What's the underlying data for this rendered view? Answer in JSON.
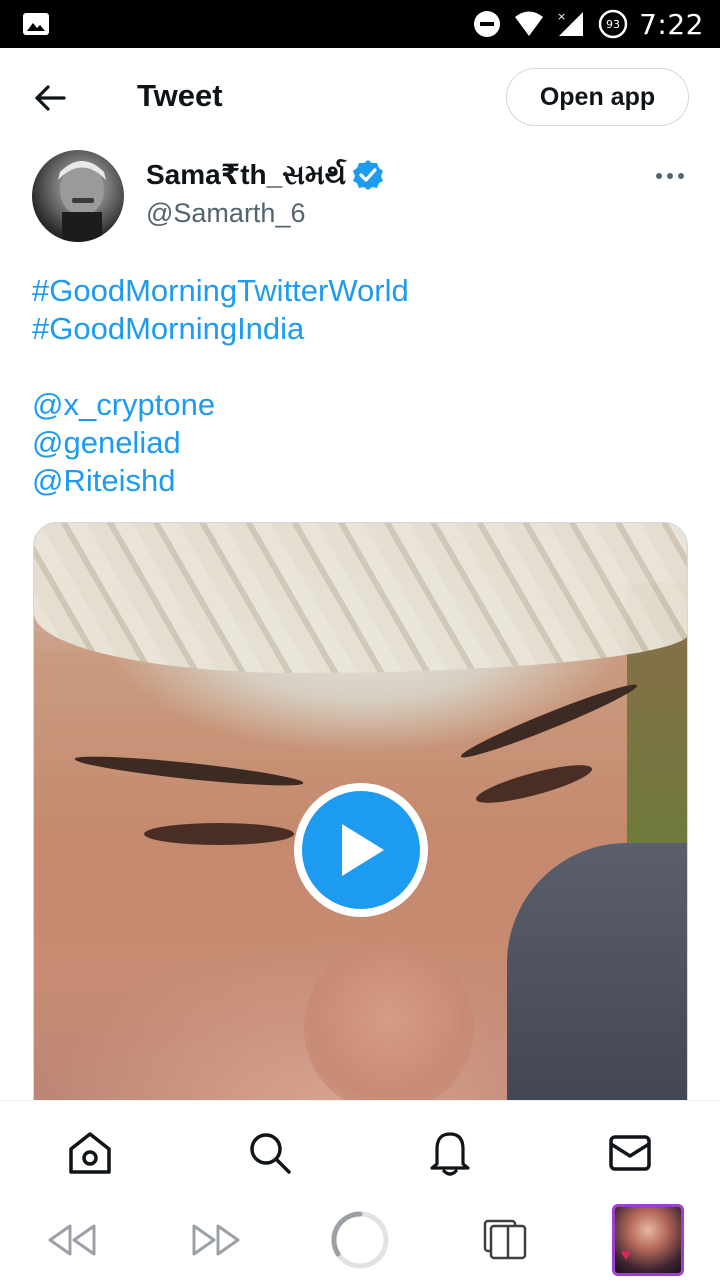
{
  "status_bar": {
    "time": "7:22",
    "battery": "93"
  },
  "header": {
    "title": "Tweet",
    "open_app_label": "Open app"
  },
  "tweet": {
    "author_name": "Sama₹th_સમર્થ",
    "author_handle": "@Samarth_6",
    "lines": {
      "hashtag_1": "#GoodMorningTwitterWorld",
      "hashtag_2": "#GoodMorningIndia",
      "mention_1": "@x_cryptone",
      "mention_2": "@geneliad",
      "mention_3": "@Riteishd"
    }
  },
  "bottom_nav": {
    "items": [
      "home-icon",
      "search-icon",
      "notifications-icon",
      "messages-icon"
    ]
  },
  "system_toolbar": {
    "items": [
      "rewind-icon",
      "fast-forward-icon",
      "loading-icon",
      "tabs-icon",
      "recent-app-thumbnail"
    ]
  },
  "colors": {
    "accent": "#1d9bf0",
    "text_primary": "#0f1419",
    "text_secondary": "#536471",
    "border": "#cfd9de"
  }
}
